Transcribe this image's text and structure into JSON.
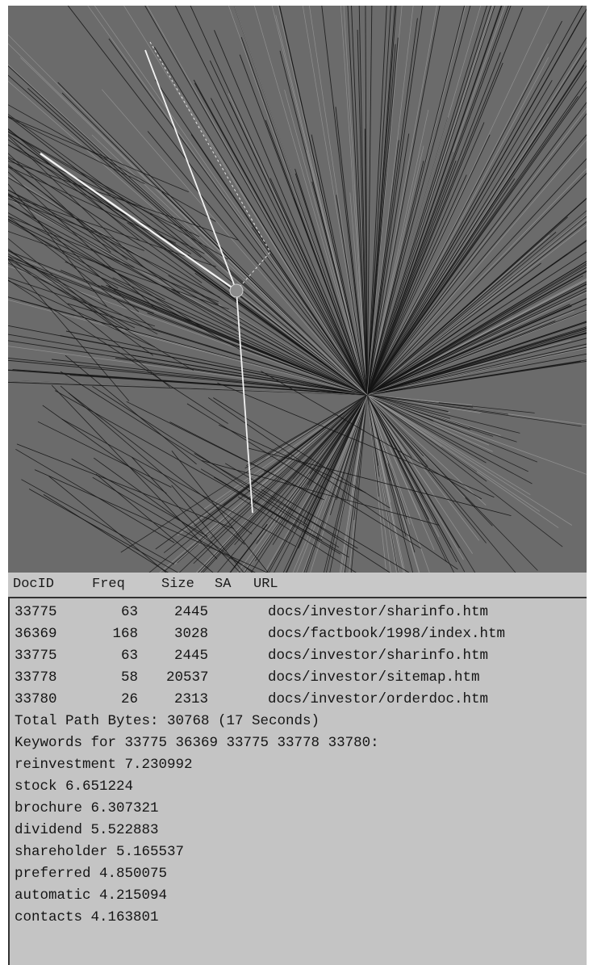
{
  "visualization": {
    "icon": "hyperbolic-tree-icon",
    "colors": {
      "background": "#6b6b6b",
      "link_dark": "#141414",
      "link_light": "#9a9a9a",
      "path_highlight": "#f2f2f2"
    }
  },
  "table": {
    "headers": {
      "docid": "DocID",
      "freq": "Freq",
      "size": "Size",
      "sa": "SA",
      "url": "URL"
    },
    "rows": [
      {
        "docid": "33775",
        "freq": "63",
        "size": "2445",
        "url": "docs/investor/sharinfo.htm"
      },
      {
        "docid": "36369",
        "freq": "168",
        "size": "3028",
        "url": "docs/factbook/1998/index.htm"
      },
      {
        "docid": "33775",
        "freq": "63",
        "size": "2445",
        "url": "docs/investor/sharinfo.htm"
      },
      {
        "docid": "33778",
        "freq": "58",
        "size": "20537",
        "url": "docs/investor/sitemap.htm"
      },
      {
        "docid": "33780",
        "freq": "26",
        "size": "2313",
        "url": "docs/investor/orderdoc.htm"
      }
    ]
  },
  "summary": {
    "total_path": "Total Path Bytes: 30768 (17 Seconds)",
    "keywords_title": "Keywords for 33775 36369 33775 33778 33780:"
  },
  "keywords": [
    "reinvestment 7.230992",
    "stock 6.651224",
    "brochure 6.307321",
    "dividend 5.522883",
    "shareholder 5.165537",
    "preferred 4.850075",
    "automatic 4.215094",
    "contacts 4.163801"
  ]
}
